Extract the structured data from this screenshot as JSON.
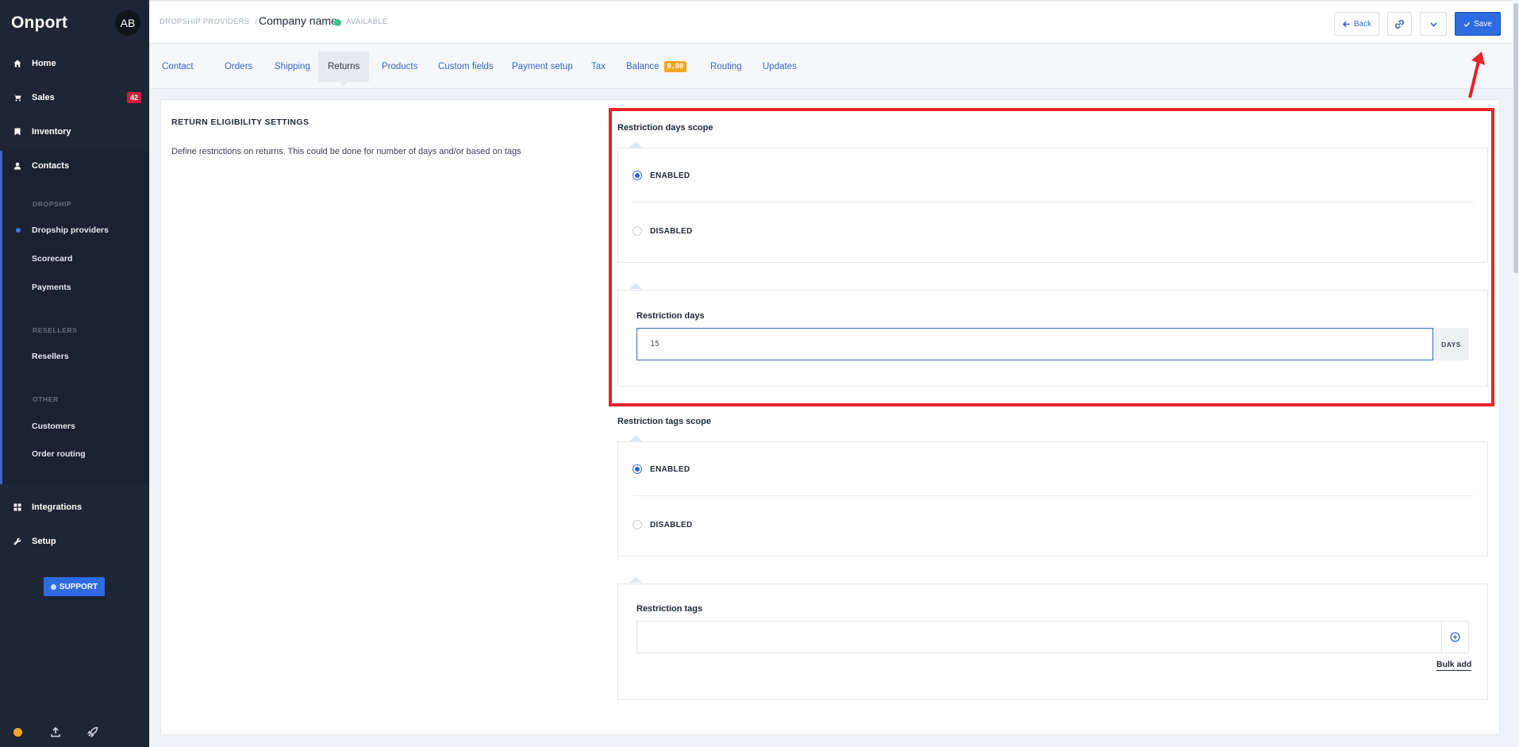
{
  "sidebar": {
    "brand": "Onport",
    "avatar": "AB",
    "nav": [
      {
        "label": "Home",
        "icon": "home-icon"
      },
      {
        "label": "Sales",
        "icon": "cart-icon",
        "badge": "42"
      },
      {
        "label": "Inventory",
        "icon": "bookmark-icon"
      },
      {
        "label": "Contacts",
        "icon": "user-icon"
      }
    ],
    "sections": {
      "dropship": "DROPSHIP",
      "resellers": "RESELLERS",
      "other": "OTHER"
    },
    "sub_items": {
      "dropship_providers": "Dropship providers",
      "scorecard": "Scorecard",
      "payments": "Payments",
      "resellers": "Resellers",
      "customers": "Customers",
      "order_routing": "Order routing"
    },
    "bottom_nav": [
      {
        "label": "Integrations",
        "icon": "grid-icon"
      },
      {
        "label": "Setup",
        "icon": "wrench-icon"
      }
    ],
    "support_label": "SUPPORT"
  },
  "header": {
    "breadcrumb": "DROPSHIP PROVIDERS",
    "separator": "/",
    "company": "Company name",
    "status": "AVAILABLE",
    "status_color": "#3ec28b",
    "back_label": "Back",
    "save_label": "Save"
  },
  "tabs": [
    {
      "label": "Contact"
    },
    {
      "label": "Orders"
    },
    {
      "label": "Shipping"
    },
    {
      "label": "Returns",
      "active": true
    },
    {
      "label": "Products"
    },
    {
      "label": "Custom fields"
    },
    {
      "label": "Payment setup"
    },
    {
      "label": "Tax"
    },
    {
      "label": "Balance",
      "badge": "0.00"
    },
    {
      "label": "Routing"
    },
    {
      "label": "Updates"
    }
  ],
  "main": {
    "title": "RETURN ELIGIBILITY SETTINGS",
    "description": "Define restrictions on returns. This could be done for number of days and/or based on tags",
    "days_scope": {
      "title": "Restriction days scope",
      "enabled_label": "ENABLED",
      "disabled_label": "DISABLED",
      "selected": "ENABLED"
    },
    "restriction_days": {
      "label": "Restriction days",
      "value": "15",
      "suffix": "DAYS"
    },
    "tags_scope": {
      "title": "Restriction tags scope",
      "enabled_label": "ENABLED",
      "disabled_label": "DISABLED",
      "selected": "ENABLED"
    },
    "restriction_tags": {
      "label": "Restriction tags",
      "value": "",
      "bulk_add": "Bulk add"
    }
  },
  "colors": {
    "accent": "#2e6be0",
    "annotation": "#e8232a",
    "sidebar_bg": "#1e2636",
    "badge_red": "#d0203c",
    "badge_orange": "#f5a623"
  }
}
